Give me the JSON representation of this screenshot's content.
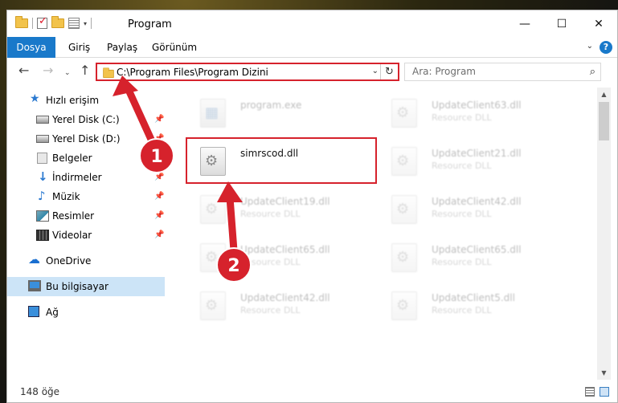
{
  "window": {
    "title": "Program",
    "controls": {
      "minimize": "—",
      "maximize": "☐",
      "close": "✕"
    }
  },
  "ribbon": {
    "tabs": [
      "Dosya",
      "Giriş",
      "Paylaş",
      "Görünüm"
    ],
    "expand_glyph": "⌄",
    "help_glyph": "?"
  },
  "nav": {
    "back": "←",
    "forward": "→",
    "recent": "⌄",
    "up": "↑",
    "address": "C:\\Program Files\\Program Dizini",
    "address_dropdown": "⌄",
    "refresh": "↻",
    "search_placeholder": "Ara: Program",
    "search_glyph": "⌕"
  },
  "sidebar": {
    "items": [
      {
        "label": "Hızlı erişim",
        "icon": "star-icon",
        "glyph": "★"
      },
      {
        "label": "Yerel Disk (C:)",
        "icon": "disk-icon",
        "pinned": true
      },
      {
        "label": "Yerel Disk (D:)",
        "icon": "disk-icon",
        "pinned": true
      },
      {
        "label": "Belgeler",
        "icon": "documents-icon",
        "pinned": true
      },
      {
        "label": "İndirmeler",
        "icon": "download-icon",
        "glyph": "↓",
        "pinned": true
      },
      {
        "label": "Müzik",
        "icon": "music-icon",
        "glyph": "♪",
        "pinned": true
      },
      {
        "label": "Resimler",
        "icon": "pictures-icon",
        "pinned": true
      },
      {
        "label": "Videolar",
        "icon": "videos-icon",
        "pinned": true
      },
      {
        "label": "OneDrive",
        "icon": "cloud-icon",
        "glyph": "☁"
      },
      {
        "label": "Bu bilgisayar",
        "icon": "computer-icon",
        "selected": true
      },
      {
        "label": "Ağ",
        "icon": "network-icon"
      }
    ],
    "pin_glyph": "📌"
  },
  "files": {
    "left": [
      {
        "name": "program.exe",
        "type": "",
        "faded": true,
        "kind": "exe"
      },
      {
        "name": "simrscod.dll",
        "type": "",
        "faded": false,
        "kind": "dll",
        "highlighted": true
      },
      {
        "name": "UpdateClient19.dll",
        "type": "Resource DLL",
        "faded": true,
        "kind": "dll"
      },
      {
        "name": "UpdateClient65.dll",
        "type": "Resource DLL",
        "faded": true,
        "kind": "dll"
      },
      {
        "name": "UpdateClient42.dll",
        "type": "Resource DLL",
        "faded": true,
        "kind": "dll"
      }
    ],
    "right": [
      {
        "name": "UpdateClient63.dll",
        "type": "Resource DLL",
        "faded": true,
        "kind": "dll"
      },
      {
        "name": "UpdateClient21.dll",
        "type": "Resource DLL",
        "faded": true,
        "kind": "dll"
      },
      {
        "name": "UpdateClient42.dll",
        "type": "Resource DLL",
        "faded": true,
        "kind": "dll"
      },
      {
        "name": "UpdateClient65.dll",
        "type": "Resource DLL",
        "faded": true,
        "kind": "dll"
      },
      {
        "name": "UpdateClient5.dll",
        "type": "Resource DLL",
        "faded": true,
        "kind": "dll"
      }
    ]
  },
  "status": {
    "item_count": "148 öğe"
  },
  "scrollbar": {
    "up": "▲",
    "down": "▼"
  },
  "annotations": {
    "badges": [
      "1",
      "2"
    ],
    "color": "#d6222c"
  }
}
